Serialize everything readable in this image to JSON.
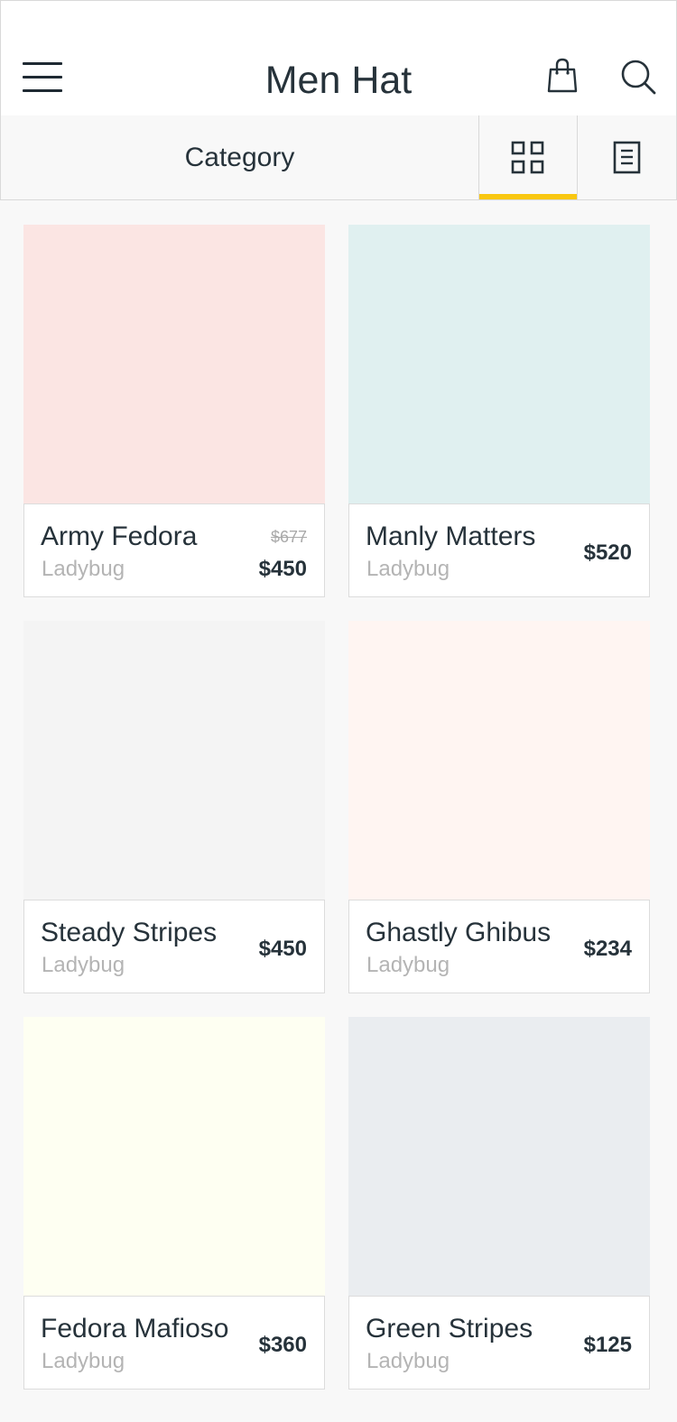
{
  "header": {
    "title": "Men Hat",
    "icons": [
      "menu-icon",
      "shopping-bag-icon",
      "search-icon"
    ]
  },
  "toolbar": {
    "category_label": "Category",
    "active_view": "grid",
    "accent_color": "#f9c710"
  },
  "products": [
    {
      "name": "Army Fedora",
      "brand": "Ladybug",
      "price": "$450",
      "old_price": "$677",
      "image_color": "#fbe5e3"
    },
    {
      "name": "Manly Matters",
      "brand": "Ladybug",
      "price": "$520",
      "old_price": "",
      "image_color": "#e0f0f0"
    },
    {
      "name": "Steady Stripes",
      "brand": "Ladybug",
      "price": "$450",
      "old_price": "",
      "image_color": "#f4f4f4"
    },
    {
      "name": "Ghastly Ghibus",
      "brand": "Ladybug",
      "price": "$234",
      "old_price": "",
      "image_color": "#fff5f2"
    },
    {
      "name": "Fedora Mafioso",
      "brand": "Ladybug",
      "price": "$360",
      "old_price": "",
      "image_color": "#fefff2"
    },
    {
      "name": "Green Stripes",
      "brand": "Ladybug",
      "price": "$125",
      "old_price": "",
      "image_color": "#eaedf0"
    }
  ]
}
